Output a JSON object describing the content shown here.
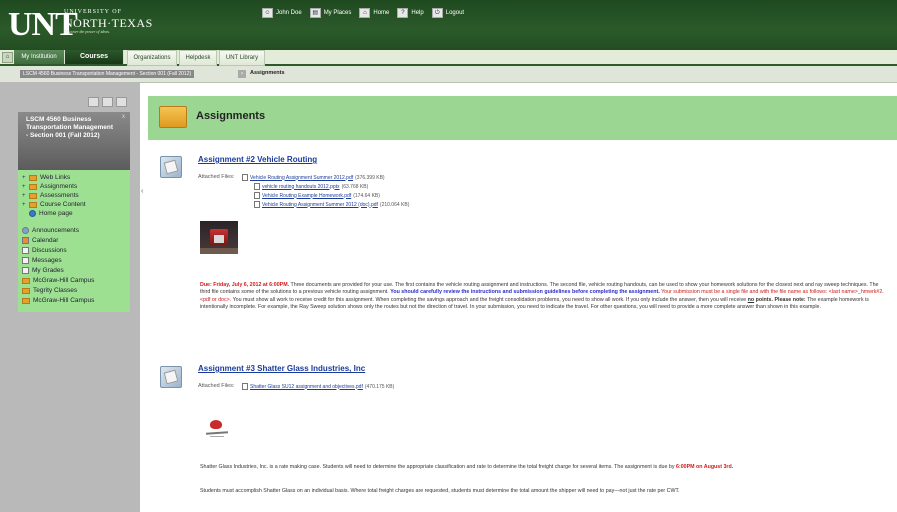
{
  "header": {
    "logo_unt": "UNT",
    "logo_university_of": "UNIVERSITY OF",
    "logo_north_texas": "NORTH·TEXAS",
    "logo_tagline": "Discover the power of ideas.",
    "links": [
      {
        "label": "John Doe",
        "icon": "user-icon"
      },
      {
        "label": "My Places",
        "icon": "places-icon"
      },
      {
        "label": "Home",
        "icon": "home-icon"
      },
      {
        "label": "Help",
        "icon": "help-icon"
      },
      {
        "label": "Logout",
        "icon": "logout-icon"
      }
    ]
  },
  "tabs": [
    {
      "label": "My Institution"
    },
    {
      "label": "Courses"
    },
    {
      "label": "Organizations"
    },
    {
      "label": "Helpdesk"
    },
    {
      "label": "UNT Library"
    }
  ],
  "breadcrumb": {
    "course": "LSCM 4560 Business Transportation Management - Section 001 (Fall 2012)",
    "current": "Assignments"
  },
  "sidebar": {
    "course_title": "LSCM 4560 Business Transportation Management - Section 001 (Fall 2012)",
    "close": "x",
    "folders": [
      {
        "label": "Web Links"
      },
      {
        "label": "Assignments"
      },
      {
        "label": "Assessments"
      },
      {
        "label": "Course Content"
      }
    ],
    "home": "Home page",
    "tools": [
      {
        "label": "Announcements",
        "icon": "announcements-icon"
      },
      {
        "label": "Calendar",
        "icon": "calendar-icon"
      },
      {
        "label": "Discussions",
        "icon": "discussions-icon"
      },
      {
        "label": "Messages",
        "icon": "messages-icon"
      },
      {
        "label": "My Grades",
        "icon": "grades-icon"
      },
      {
        "label": "McGraw-Hill Campus",
        "icon": "folder-icon"
      },
      {
        "label": "Tegrity Classes",
        "icon": "folder-icon"
      },
      {
        "label": "McGraw-Hill Campus",
        "icon": "folder-icon"
      }
    ]
  },
  "main": {
    "title": "Assignments",
    "attached_label": "Attached Files:",
    "assignments": [
      {
        "title": "Assignment #2 Vehicle Routing",
        "files": [
          {
            "name": "Vehicle Routing Assignment Summer 2012.pdf",
            "size": "(376.399 KB)"
          },
          {
            "name": "vehicle routing handouts 2012.pptx",
            "size": "(63.768 KB)"
          },
          {
            "name": "Vehicle Routing Example Homework.pdf",
            "size": "(174.64 KB)"
          },
          {
            "name": "Vehicle Routing Assignment Summer 2012 (doc).pdf",
            "size": "(210.064 KB)"
          }
        ],
        "due": "Due: Friday, July 6, 2012 at 6:00PM.",
        "desc1": " Three documents are provided for your use. The first contains the vehicle routing assignment and instructions. The second file, vehicle routing handouts, can be used to show your homework solutions for the closest next and ray sweep techniques. The third file contains some of the solutions to a previous vehicle routing assignment. ",
        "desc_blue": "You should carefully review the instructions and submission guidelines before completing the assignment.",
        "desc_red_normal": " Your submission must be a single file and with the file name as follows: <last name>_hmwrk#2.<pdf or doc>.",
        "desc2": " You must show all work to receive credit for this assignment. When completing the savings approach and the freight consolidation problems, you need to show all work. If you only include the answer, then you will receive ",
        "desc_no": "no",
        "desc_points": " points.",
        "desc_note": "Please note:",
        "desc3": " The example homework is intentionally incomplete. For example, the Ray Sweep solution shows only the routes but not the direction of travel. In your submission, you need to indicate the travel. For other questions, you will need to provide a more complete answer than shown in this example."
      },
      {
        "title": "Assignment #3 Shatter Glass Industries, Inc",
        "files": [
          {
            "name": "Shatter Glass SU12 assignment and objectives.pdf",
            "size": "(470.175 KB)"
          }
        ],
        "desc1": "Shatter Glass Industries, Inc. is a rate making case. Students will need to determine the appropriate classification and rate to determine the total freight charge for several items. The assignment is due by ",
        "due": "6:00PM on August 3rd.",
        "desc2": "Students must accomplish Shatter Glass on an individual basis. Where total freight charges are requested, students must determine the total amount the shipper will need to pay—not just the rate per CWT."
      }
    ]
  }
}
